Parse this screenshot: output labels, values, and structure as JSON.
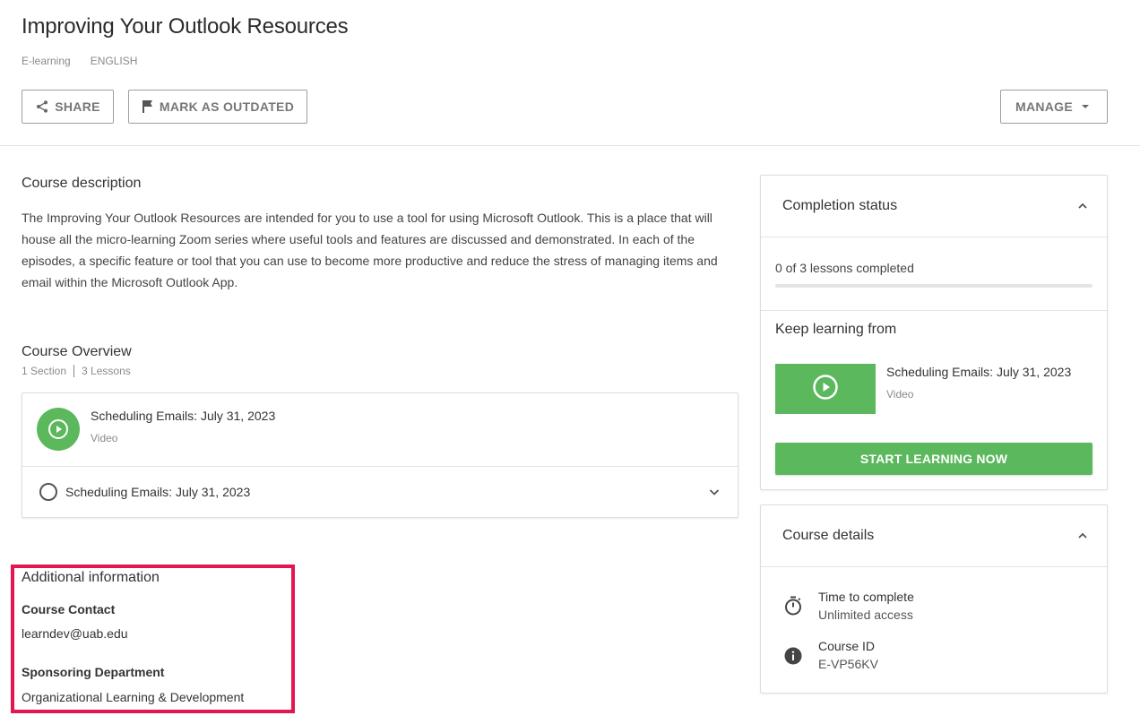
{
  "header": {
    "title": "Improving Your Outlook Resources",
    "type": "E-learning",
    "language": "ENGLISH"
  },
  "toolbar": {
    "share_label": "SHARE",
    "share_icon": "share-icon",
    "outdated_label": "MARK AS OUTDATED",
    "outdated_icon": "flag-icon",
    "manage_label": "MANAGE",
    "manage_icon": "caret-down-icon"
  },
  "description": {
    "heading": "Course description",
    "text": "The Improving Your Outlook Resources are intended for you to use a tool for using Microsoft Outlook. This is a place that will house all the micro-learning Zoom series where useful tools and features are discussed and demonstrated. In each of the episodes, a specific feature or tool that you can use to become more productive and reduce the stress of managing items and email within the Microsoft Outlook App."
  },
  "overview": {
    "heading": "Course Overview",
    "sections": "1 Section",
    "lessons": "3 Lessons",
    "items": [
      {
        "title": "Scheduling Emails: July 31, 2023",
        "type": "Video"
      },
      {
        "title": "Scheduling Emails: July 31, 2023"
      }
    ]
  },
  "additional": {
    "heading": "Additional information",
    "contact_label": "Course Contact",
    "contact_value": "learndev@uab.edu",
    "department_label": "Sponsoring Department",
    "department_value": "Organizational Learning & Development"
  },
  "completion": {
    "heading": "Completion status",
    "progress_text": "0 of 3 lessons completed",
    "progress_fraction": 0,
    "keep_heading": "Keep learning from",
    "keep_lesson_title": "Scheduling Emails: July 31, 2023",
    "keep_lesson_type": "Video",
    "start_label": "START LEARNING NOW"
  },
  "details": {
    "heading": "Course details",
    "time_label": "Time to complete",
    "time_value": "Unlimited access",
    "id_label": "Course ID",
    "id_value": "E-VP56KV"
  },
  "colors": {
    "accent_green": "#5cb85c",
    "highlight_red": "#e3164f"
  }
}
